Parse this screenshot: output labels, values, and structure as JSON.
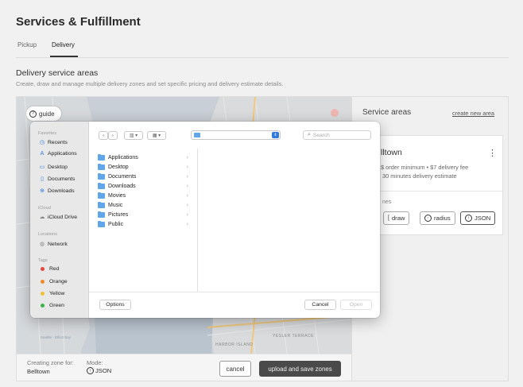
{
  "page": {
    "title": "Services & Fulfillment",
    "tabs": [
      {
        "label": "Pickup",
        "active": false
      },
      {
        "label": "Delivery",
        "active": true
      }
    ],
    "section_title": "Delivery service areas",
    "section_description": "Create, draw and manage multiple delivery zones and set specific pricing and delivery estimate details."
  },
  "map": {
    "guide_label": "guide",
    "labels": {
      "left_bay": "Seattle · Elliott Bay",
      "harbor": "HARBOR ISLAND",
      "terrace": "YESLER TERRACE"
    }
  },
  "bottom_bar": {
    "creating_label": "Creating zone for:",
    "creating_value": "Belltown",
    "mode_label": "Mode:",
    "mode_value": "JSON",
    "cancel_label": "cancel",
    "upload_label": "upload and save zones"
  },
  "service_areas": {
    "title": "Service areas",
    "create_link": "create new area",
    "zone": {
      "name": "lltown",
      "detail_line1": "$ order minimum • $7 delivery fee",
      "detail_line2": "30 minutes delivery estimate",
      "zones_label": "nes",
      "modes": [
        {
          "label": "draw",
          "selected": false
        },
        {
          "label": "radius",
          "selected": false
        },
        {
          "label": "JSON",
          "selected": true
        }
      ]
    }
  },
  "file_dialog": {
    "favorites_header": "Favorites",
    "favorites": [
      {
        "label": "Recents",
        "icon": "clock-icon"
      },
      {
        "label": "Applications",
        "icon": "applications-icon"
      },
      {
        "label": "Desktop",
        "icon": "desktop-icon"
      },
      {
        "label": "Documents",
        "icon": "document-icon"
      },
      {
        "label": "Downloads",
        "icon": "download-icon"
      }
    ],
    "icloud_header": "iCloud",
    "icloud": [
      {
        "label": "iCloud Drive",
        "icon": "cloud-icon"
      }
    ],
    "locations_header": "Locations",
    "locations": [
      {
        "label": "Network",
        "icon": "globe-icon"
      }
    ],
    "tags_header": "Tags",
    "tags": [
      {
        "label": "Red",
        "color": "#e5463d"
      },
      {
        "label": "Orange",
        "color": "#f08a24"
      },
      {
        "label": "Yellow",
        "color": "#f2c037"
      },
      {
        "label": "Green",
        "color": "#3cb34a"
      }
    ],
    "search_placeholder": "Search",
    "folders": [
      "Applications",
      "Desktop",
      "Documents",
      "Downloads",
      "Movies",
      "Music",
      "Pictures",
      "Public"
    ],
    "options_label": "Options",
    "cancel_label": "Cancel",
    "open_label": "Open"
  }
}
